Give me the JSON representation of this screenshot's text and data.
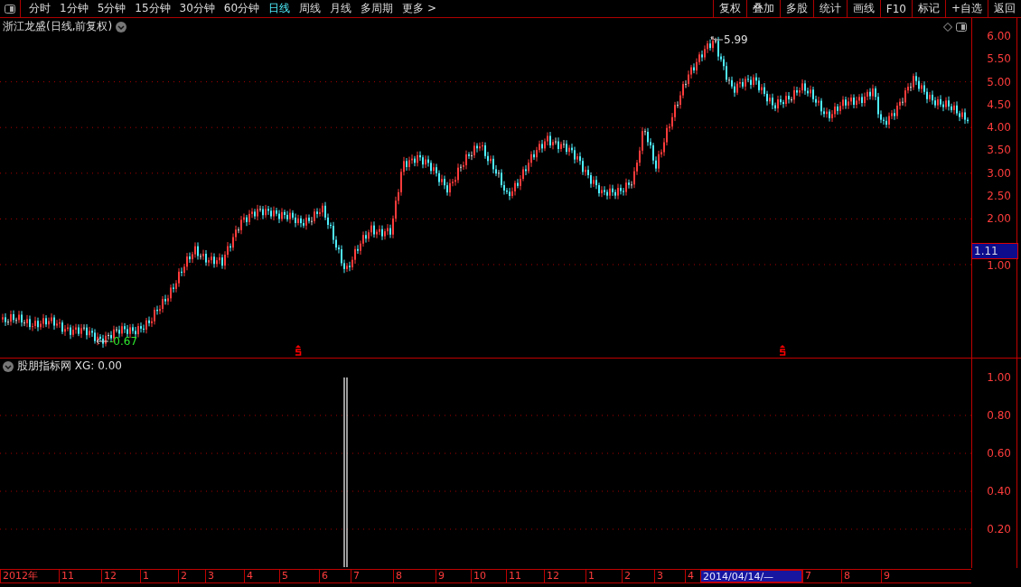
{
  "toolbar": {
    "periods": [
      {
        "label": "分时",
        "selected": false
      },
      {
        "label": "1分钟",
        "selected": false
      },
      {
        "label": "5分钟",
        "selected": false
      },
      {
        "label": "15分钟",
        "selected": false
      },
      {
        "label": "30分钟",
        "selected": false
      },
      {
        "label": "60分钟",
        "selected": false
      },
      {
        "label": "日线",
        "selected": true
      },
      {
        "label": "周线",
        "selected": false
      },
      {
        "label": "月线",
        "selected": false
      },
      {
        "label": "多周期",
        "selected": false
      },
      {
        "label": "更多 >",
        "selected": false
      }
    ],
    "actions": [
      "复权",
      "叠加",
      "多股",
      "统计",
      "画线",
      "F10",
      "标记",
      "+自选",
      "返回"
    ]
  },
  "price_panel": {
    "title": "浙江龙盛(日线,前复权)",
    "high_label": "5.99",
    "low_label": "-0.67",
    "y_ticks": [
      "6.00",
      "5.50",
      "5.00",
      "4.50",
      "4.00",
      "3.50",
      "3.00",
      "2.50",
      "2.00",
      "1.00"
    ],
    "last_price": "1.11"
  },
  "indicator_panel": {
    "title": "股朋指标网 XG: 0.00",
    "y_ticks": [
      "1.00",
      "0.80",
      "0.60",
      "0.40",
      "0.20"
    ]
  },
  "time_axis": [
    {
      "label": "2012年",
      "selected": false
    },
    {
      "label": "11",
      "selected": false
    },
    {
      "label": "12",
      "selected": false
    },
    {
      "label": "1",
      "selected": false
    },
    {
      "label": "2",
      "selected": false
    },
    {
      "label": "3",
      "selected": false
    },
    {
      "label": "4",
      "selected": false
    },
    {
      "label": "5",
      "selected": false
    },
    {
      "label": "6",
      "selected": false
    },
    {
      "label": "7",
      "selected": false
    },
    {
      "label": "8",
      "selected": false
    },
    {
      "label": "9",
      "selected": false
    },
    {
      "label": "10",
      "selected": false
    },
    {
      "label": "11",
      "selected": false
    },
    {
      "label": "12",
      "selected": false
    },
    {
      "label": "1",
      "selected": false
    },
    {
      "label": "2",
      "selected": false
    },
    {
      "label": "3",
      "selected": false
    },
    {
      "label": "4",
      "selected": false
    },
    {
      "label": "2014/04/14/—",
      "selected": true
    },
    {
      "label": "7",
      "selected": false
    },
    {
      "label": "8",
      "selected": false
    },
    {
      "label": "9",
      "selected": false
    }
  ]
}
